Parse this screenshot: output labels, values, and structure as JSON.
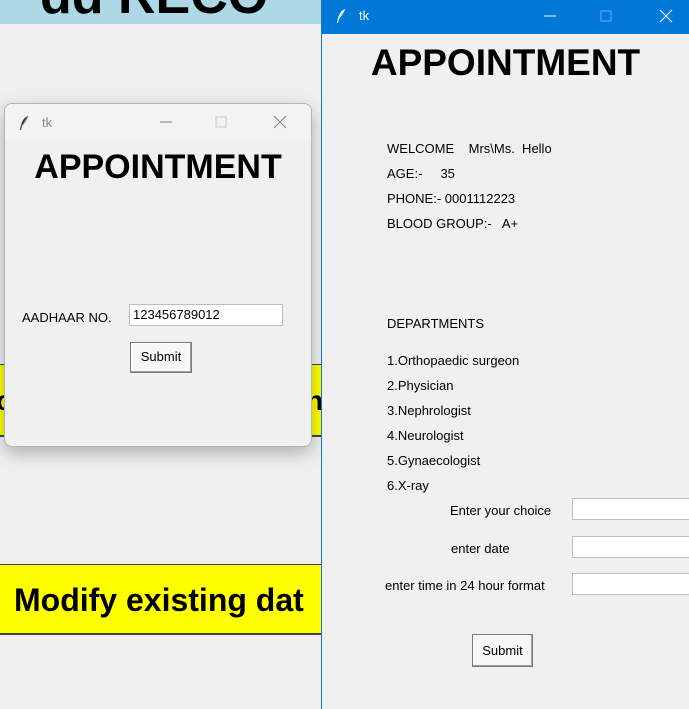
{
  "background_app": {
    "title_fragment": "dd RECO",
    "yellow_button_1_left": "o",
    "yellow_button_1_right": "ny",
    "yellow_button_2": "Modify existing dat"
  },
  "small_window": {
    "title": "tk",
    "heading": "APPOINTMENT",
    "aadhaar_label": "AADHAAR NO.",
    "aadhaar_value": "123456789012",
    "submit_label": "Submit"
  },
  "big_window": {
    "title": "tk",
    "heading": "APPOINTMENT",
    "welcome": "WELCOME    Mrs\\Ms.  Hello",
    "age": "AGE:-     35",
    "phone": "PHONE:- 0001112223",
    "blood_group": "BLOOD GROUP:-   A+",
    "departments_heading": "DEPARTMENTS",
    "departments": [
      "1.Orthopaedic surgeon",
      "2.Physician",
      "3.Nephrologist",
      "4.Neurologist",
      "5.Gynaecologist",
      "6.X-ray"
    ],
    "choice_label": "Enter your choice",
    "date_label": "enter date",
    "time_label": "enter time in 24 hour format",
    "submit_label": "Submit"
  },
  "colors": {
    "active_titlebar": "#0078d7",
    "yellow_button": "#ffff00",
    "header_band": "#add8e6"
  },
  "icons": [
    "feather-icon",
    "minimize-icon",
    "maximize-icon",
    "close-icon"
  ]
}
